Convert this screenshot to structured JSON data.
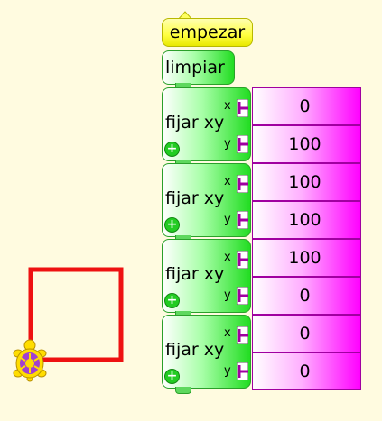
{
  "blocks": {
    "start": "empezar",
    "clear": "limpiar",
    "set_xy": [
      {
        "label": "fijar xy",
        "x_arg": "x",
        "y_arg": "y",
        "x_value": "0",
        "y_value": "100"
      },
      {
        "label": "fijar xy",
        "x_arg": "x",
        "y_arg": "y",
        "x_value": "100",
        "y_value": "100"
      },
      {
        "label": "fijar xy",
        "x_arg": "x",
        "y_arg": "y",
        "x_value": "100",
        "y_value": "0"
      },
      {
        "label": "fijar xy",
        "x_arg": "x",
        "y_arg": "y",
        "x_value": "0",
        "y_value": "0"
      }
    ]
  },
  "colors": {
    "background": "#fffbe0",
    "pen": "#ee1111",
    "start_block": "#ffff40",
    "action_block": "#22dd22",
    "number_block": "#ff00ff"
  },
  "turtle": {
    "icon": "turtle-icon"
  },
  "drawing": {
    "shape": "square",
    "side": 100
  }
}
